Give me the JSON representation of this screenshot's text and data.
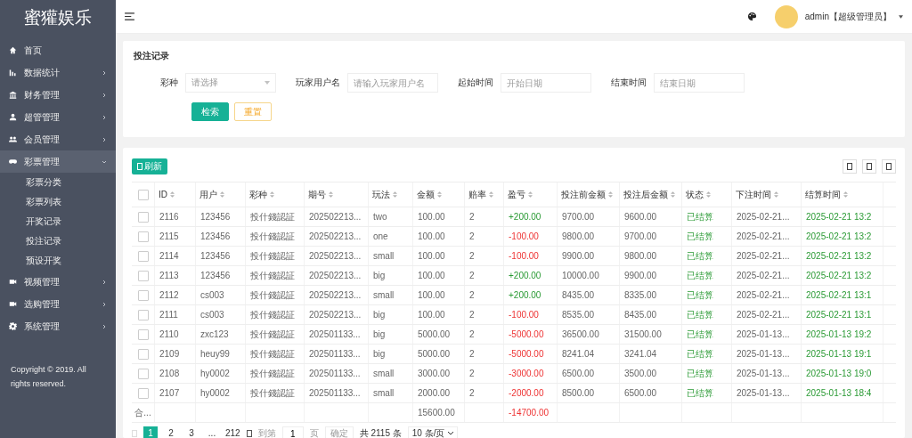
{
  "sidebar": {
    "logo": "蜜獾娱乐",
    "items": [
      {
        "label": "首页",
        "has_children": false,
        "expanded": false
      },
      {
        "label": "数据统计",
        "has_children": true,
        "expanded": false
      },
      {
        "label": "财务管理",
        "has_children": true,
        "expanded": false
      },
      {
        "label": "超管管理",
        "has_children": true,
        "expanded": false
      },
      {
        "label": "会员管理",
        "has_children": true,
        "expanded": false
      },
      {
        "label": "彩票管理",
        "has_children": true,
        "expanded": true,
        "children": [
          {
            "label": "彩票分类"
          },
          {
            "label": "彩票列表"
          },
          {
            "label": "开奖记录"
          },
          {
            "label": "投注记录"
          },
          {
            "label": "预设开奖"
          }
        ]
      },
      {
        "label": "视频管理",
        "has_children": true,
        "expanded": false
      },
      {
        "label": "选购管理",
        "has_children": true,
        "expanded": false
      },
      {
        "label": "系统管理",
        "has_children": true,
        "expanded": false
      }
    ],
    "copyright": "Copyright © 2019. All rights reserved."
  },
  "header": {
    "user": "admin【超级管理员】"
  },
  "search": {
    "title": "投注记录",
    "fields": [
      {
        "kind": "select",
        "label": "彩种",
        "placeholder": "请选择"
      },
      {
        "kind": "input",
        "label": "玩家用户名",
        "placeholder": "请输入玩家用户名"
      },
      {
        "kind": "input",
        "label": "起始时间",
        "placeholder": "开始日期"
      },
      {
        "kind": "input",
        "label": "结束时间",
        "placeholder": "结束日期"
      }
    ],
    "buttons": [
      {
        "kind": "primary",
        "label": "检索"
      },
      {
        "kind": "warn",
        "label": "重置"
      }
    ]
  },
  "table": {
    "refresh": "刷新",
    "all_checked": false,
    "columns": [
      "ID",
      "用户",
      "彩种",
      "期号",
      "玩法",
      "金额",
      "赔率",
      "盈亏",
      "投注前金额",
      "投注后金额",
      "状态",
      "下注时间",
      "结算时间"
    ],
    "rows": [
      {
        "checked": false,
        "gain": true,
        "cells": [
          "2116",
          "123456",
          "投什錢認証",
          "202502213...",
          "two",
          "100.00",
          "2",
          "+200.00",
          "9700.00",
          "9600.00",
          "已结算",
          "2025-02-21...",
          "2025-02-21 13:2"
        ]
      },
      {
        "checked": false,
        "gain": false,
        "cells": [
          "2115",
          "123456",
          "投什錢認証",
          "202502213...",
          "one",
          "100.00",
          "2",
          "-100.00",
          "9800.00",
          "9700.00",
          "已结算",
          "2025-02-21...",
          "2025-02-21 13:2"
        ]
      },
      {
        "checked": false,
        "gain": false,
        "cells": [
          "2114",
          "123456",
          "投什錢認証",
          "202502213...",
          "small",
          "100.00",
          "2",
          "-100.00",
          "9900.00",
          "9800.00",
          "已结算",
          "2025-02-21...",
          "2025-02-21 13:2"
        ]
      },
      {
        "checked": false,
        "gain": true,
        "cells": [
          "2113",
          "123456",
          "投什錢認証",
          "202502213...",
          "big",
          "100.00",
          "2",
          "+200.00",
          "10000.00",
          "9900.00",
          "已结算",
          "2025-02-21...",
          "2025-02-21 13:2"
        ]
      },
      {
        "checked": false,
        "gain": true,
        "cells": [
          "2112",
          "cs003",
          "投什錢認証",
          "202502213...",
          "small",
          "100.00",
          "2",
          "+200.00",
          "8435.00",
          "8335.00",
          "已结算",
          "2025-02-21...",
          "2025-02-21 13:1"
        ]
      },
      {
        "checked": false,
        "gain": false,
        "cells": [
          "2111",
          "cs003",
          "投什錢認証",
          "202502213...",
          "big",
          "100.00",
          "2",
          "-100.00",
          "8535.00",
          "8435.00",
          "已结算",
          "2025-02-21...",
          "2025-02-21 13:1"
        ]
      },
      {
        "checked": false,
        "gain": false,
        "cells": [
          "2110",
          "zxc123",
          "投什錢認証",
          "202501133...",
          "big",
          "5000.00",
          "2",
          "-5000.00",
          "36500.00",
          "31500.00",
          "已结算",
          "2025-01-13...",
          "2025-01-13 19:2"
        ]
      },
      {
        "checked": false,
        "gain": false,
        "cells": [
          "2109",
          "heuy99",
          "投什錢認証",
          "202501133...",
          "big",
          "5000.00",
          "2",
          "-5000.00",
          "8241.04",
          "3241.04",
          "已结算",
          "2025-01-13...",
          "2025-01-13 19:1"
        ]
      },
      {
        "checked": false,
        "gain": false,
        "cells": [
          "2108",
          "hy0002",
          "投什錢認証",
          "202501133...",
          "small",
          "3000.00",
          "2",
          "-3000.00",
          "6500.00",
          "3500.00",
          "已结算",
          "2025-01-13...",
          "2025-01-13 19:0"
        ]
      },
      {
        "checked": false,
        "gain": false,
        "cells": [
          "2107",
          "hy0002",
          "投什錢認証",
          "202501133...",
          "small",
          "2000.00",
          "2",
          "-2000.00",
          "8500.00",
          "6500.00",
          "已结算",
          "2025-01-13...",
          "2025-01-13 18:4"
        ]
      }
    ],
    "total": {
      "label": "合...",
      "amount": "15600.00",
      "profit": "-14700.00"
    }
  },
  "pagination": {
    "pages": [
      {
        "label": "1",
        "selected": true
      },
      {
        "label": "2",
        "selected": false
      },
      {
        "label": "3",
        "selected": false
      },
      {
        "label": "...",
        "selected": false
      },
      {
        "label": "212",
        "selected": false
      }
    ],
    "goto_label": "到第",
    "goto_value": "1",
    "page_unit": "页",
    "confirm": "确定",
    "total": "共 2115 条",
    "page_size": "10 条/页"
  }
}
